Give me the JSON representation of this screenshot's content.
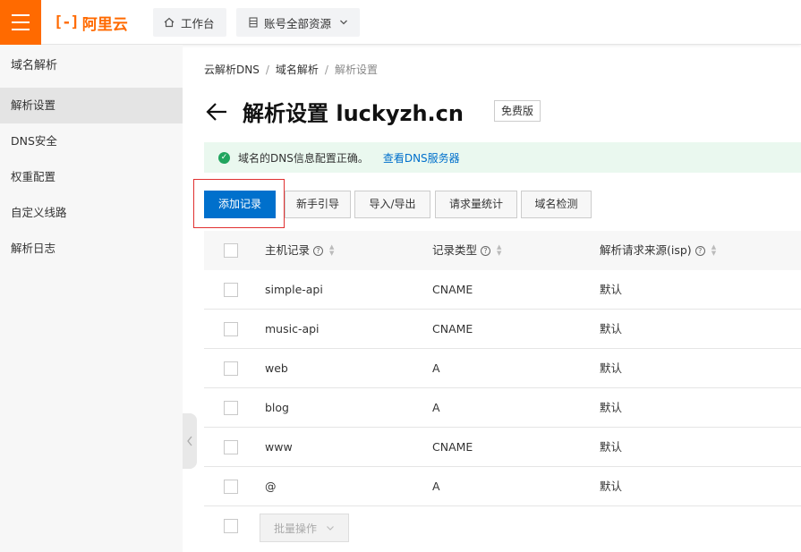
{
  "topbar": {
    "logo_mark": "[-]",
    "logo_text": "阿里云",
    "workbench_label": "工作台",
    "resources_label": "账号全部资源"
  },
  "sidebar": {
    "title": "域名解析",
    "items": [
      {
        "label": "解析设置",
        "active": true
      },
      {
        "label": "DNS安全",
        "active": false
      },
      {
        "label": "权重配置",
        "active": false
      },
      {
        "label": "自定义线路",
        "active": false
      },
      {
        "label": "解析日志",
        "active": false
      }
    ]
  },
  "breadcrumb": [
    "云解析DNS",
    "域名解析",
    "解析设置"
  ],
  "page": {
    "title": "解析设置 luckyzh.cn",
    "edition": "免费版"
  },
  "alert": {
    "message": "域名的DNS信息配置正确。",
    "link": "查看DNS服务器"
  },
  "toolbar": {
    "add_record": "添加记录",
    "guide": "新手引导",
    "import_export": "导入/导出",
    "request_stats": "请求量统计",
    "domain_check": "域名检测"
  },
  "table": {
    "headers": {
      "host": "主机记录",
      "type": "记录类型",
      "line": "解析请求来源(isp)"
    },
    "rows": [
      {
        "host": "simple-api",
        "type": "CNAME",
        "line": "默认"
      },
      {
        "host": "music-api",
        "type": "CNAME",
        "line": "默认"
      },
      {
        "host": "web",
        "type": "A",
        "line": "默认"
      },
      {
        "host": "blog",
        "type": "A",
        "line": "默认"
      },
      {
        "host": "www",
        "type": "CNAME",
        "line": "默认"
      },
      {
        "host": "@",
        "type": "A",
        "line": "默认"
      }
    ]
  },
  "batch": {
    "label": "批量操作"
  },
  "colors": {
    "brand": "#ff6a00",
    "primary": "#0070cc",
    "success": "#21a55f",
    "highlight": "#e03030"
  }
}
